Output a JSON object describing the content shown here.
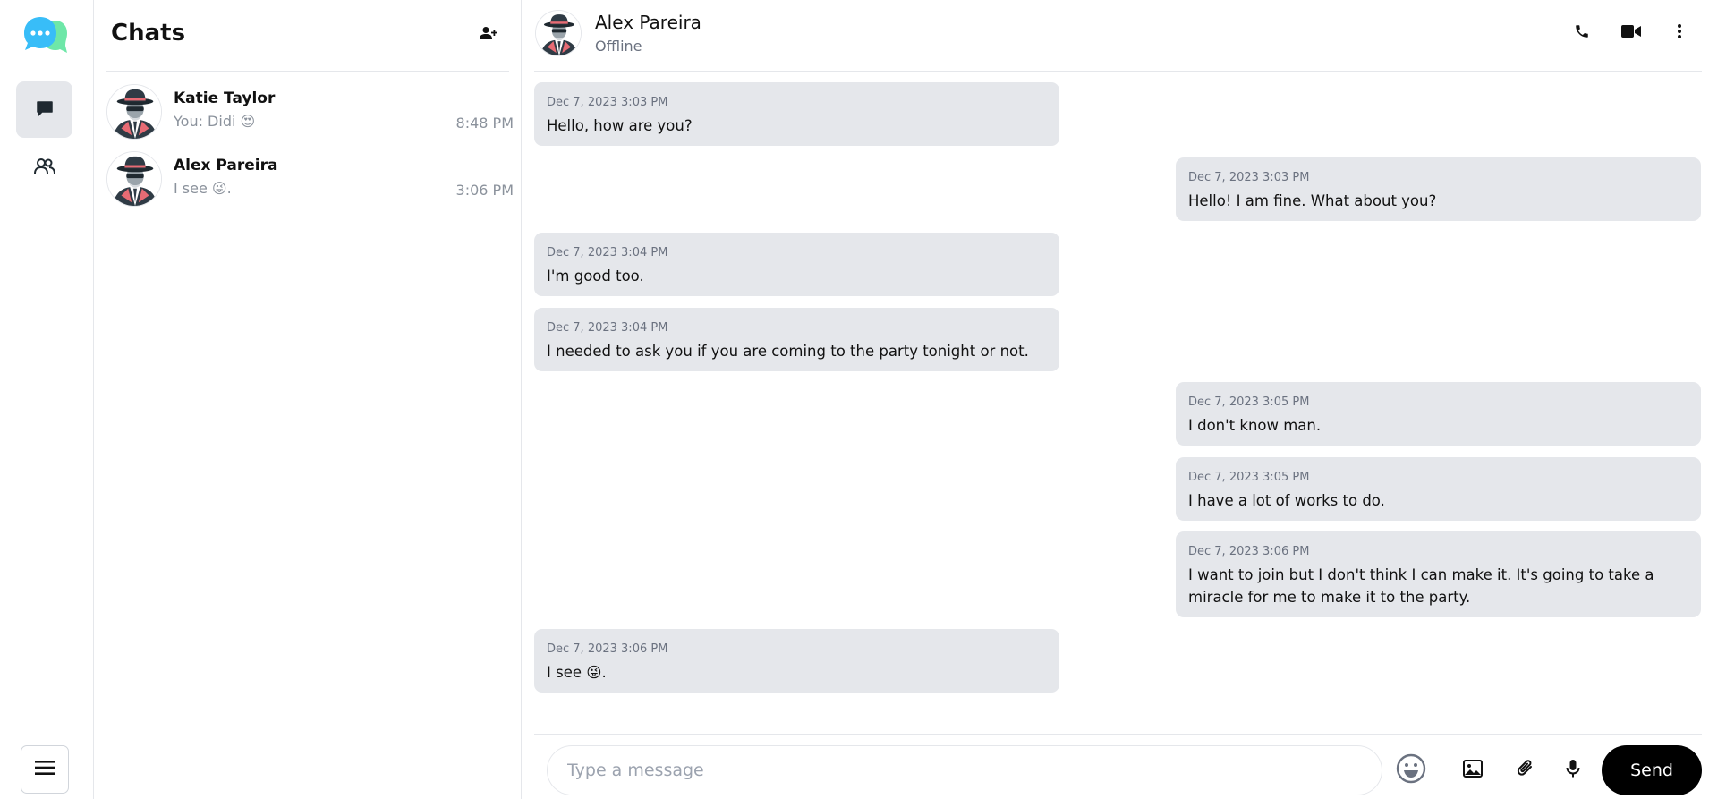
{
  "app": {
    "colors": {
      "logo_back_bubble": "#4ade80",
      "logo_front_bubble": "#38bdf8",
      "bubble_bg": "#e5e7eb",
      "muted_text": "#8b929c",
      "send_bg": "#000000"
    }
  },
  "rail": {
    "logo_icon": "chat-bubbles-logo",
    "items": [
      {
        "icon": "chat-bubble-icon",
        "active": true
      },
      {
        "icon": "users-icon",
        "active": false
      }
    ],
    "menu_icon": "hamburger-icon"
  },
  "chatlist": {
    "title": "Chats",
    "add_icon": "add-user-icon",
    "items": [
      {
        "name": "Katie Taylor",
        "preview": "You: Didi 😍",
        "time": "8:48 PM",
        "avatar_icon": "spy-avatar"
      },
      {
        "name": "Alex Pareira",
        "preview": "I see 😜.",
        "time": "3:06 PM",
        "avatar_icon": "spy-avatar"
      }
    ]
  },
  "conversation": {
    "name": "Alex Pareira",
    "status": "Offline",
    "avatar_icon": "spy-avatar",
    "actions": [
      "phone-icon",
      "video-icon",
      "more-vertical-icon"
    ],
    "messages": [
      {
        "direction": "in",
        "timestamp": "Dec 7, 2023 3:03 PM",
        "text": "Hello, how are you?"
      },
      {
        "direction": "out",
        "timestamp": "Dec 7, 2023 3:03 PM",
        "text": "Hello! I am fine. What about you?"
      },
      {
        "direction": "in",
        "timestamp": "Dec 7, 2023 3:04 PM",
        "text": "I'm good too."
      },
      {
        "direction": "in",
        "timestamp": "Dec 7, 2023 3:04 PM",
        "text": "I needed to ask you if you are coming to the party tonight or not."
      },
      {
        "direction": "out",
        "timestamp": "Dec 7, 2023 3:05 PM",
        "text": "I don't know man."
      },
      {
        "direction": "out",
        "timestamp": "Dec 7, 2023 3:05 PM",
        "text": "I have a lot of works to do."
      },
      {
        "direction": "out",
        "timestamp": "Dec 7, 2023 3:06 PM",
        "text": "I want to join but I don't think I can make it. It's going to take a miracle for me to make it to the party."
      },
      {
        "direction": "in",
        "timestamp": "Dec 7, 2023 3:06 PM",
        "text": "I see 😜."
      }
    ]
  },
  "composer": {
    "placeholder": "Type a message",
    "value": "",
    "icons": [
      "emoji-icon",
      "image-icon",
      "paperclip-icon",
      "microphone-icon"
    ],
    "send_label": "Send"
  }
}
